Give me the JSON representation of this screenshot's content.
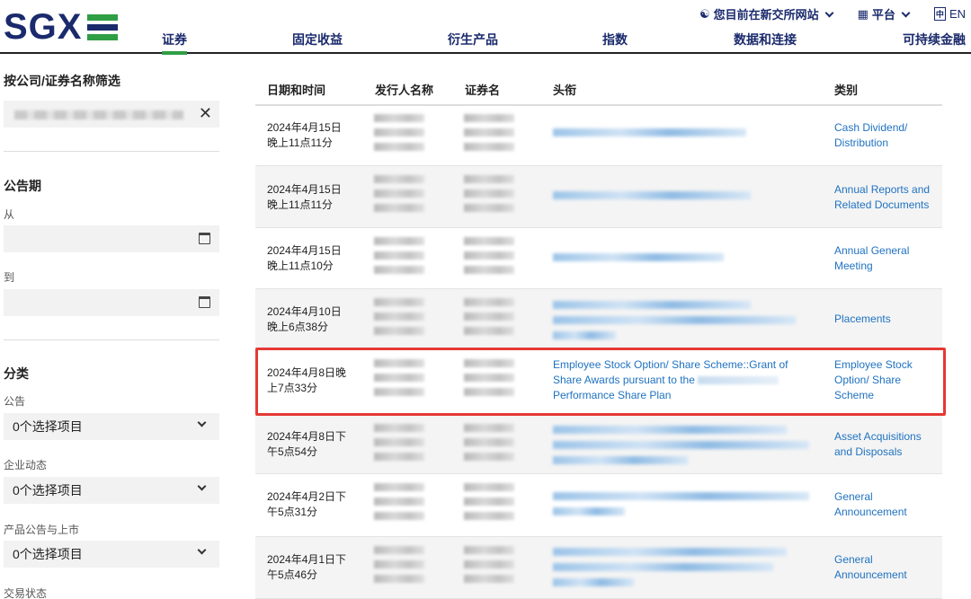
{
  "header": {
    "logo": "SGX",
    "util": {
      "network": "您目前在新交所网站",
      "platform": "平台",
      "lang": "EN"
    },
    "tabs": [
      {
        "label": "证券",
        "active": true
      },
      {
        "label": "固定收益"
      },
      {
        "label": "衍生产品"
      },
      {
        "label": "指数"
      },
      {
        "label": "数据和连接"
      },
      {
        "label": "可持续金融"
      }
    ]
  },
  "sidebar": {
    "filter_title": "按公司/证券名称筛选",
    "period_title": "公告期",
    "from_label": "从",
    "to_label": "到",
    "category_title": "分类",
    "groups": [
      {
        "label": "公告",
        "value": "0个选择项目"
      },
      {
        "label": "企业动态",
        "value": "0个选择项目"
      },
      {
        "label": "产品公告与上市",
        "value": "0个选择项目"
      },
      {
        "label": "交易状态"
      }
    ]
  },
  "table": {
    "columns": [
      "日期和时间",
      "发行人名称",
      "证券名",
      "头衔",
      "类别"
    ],
    "rows": [
      {
        "date": "2024年4月15日\n晚上11点11分",
        "category": "Cash Dividend/ Distribution"
      },
      {
        "date": "2024年4月15日\n晚上11点11分",
        "category": "Annual Reports and Related Documents"
      },
      {
        "date": "2024年4月15日\n晚上11点10分",
        "category": "Annual General Meeting"
      },
      {
        "date": "2024年4月10日\n晚上6点38分",
        "category": "Placements"
      },
      {
        "date": "2024年4月8日晚上7点33分",
        "headline": "Employee Stock Option/ Share Scheme::Grant of Share Awards pursuant to the",
        "headline_end": "Performance Share Plan",
        "category": "Employee Stock Option/ Share Scheme"
      },
      {
        "date": "2024年4月8日下午5点54分",
        "category": "Asset Acquisitions and Disposals"
      },
      {
        "date": "2024年4月2日下午5点31分",
        "category": "General Announcement"
      },
      {
        "date": "2024年4月1日下午5点46分",
        "category": "General Announcement"
      }
    ]
  },
  "colors": {
    "brand_navy": "#1a2a6c",
    "brand_green": "#2f9e44",
    "link": "#1f72c0",
    "highlight": "#e53935"
  }
}
